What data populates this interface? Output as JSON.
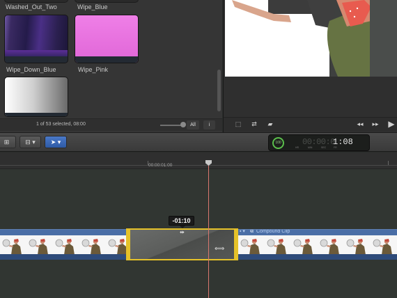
{
  "browser": {
    "clips": [
      {
        "name": "Washed_Out_Two"
      },
      {
        "name": "Wipe_Blue"
      },
      {
        "name": "Wipe_Down_Blue"
      },
      {
        "name": "Wipe_Pink"
      },
      {
        "name": ""
      }
    ],
    "status": "1 of 53 selected, 08:00",
    "filter_label": "All",
    "action_label": "i"
  },
  "viewer": {
    "controls": [
      "fit",
      "transform",
      "crop",
      "prev",
      "next",
      "play"
    ]
  },
  "toolbar": {
    "tools": [
      "append",
      "insert",
      "select-tool"
    ],
    "timecode": {
      "indicator": "100",
      "dim_digits": "00:00:0",
      "value": "1:08",
      "units": [
        "HR",
        "MIN",
        "SEC",
        "FR"
      ]
    }
  },
  "timeline": {
    "ruler_label": "00:00:01:00",
    "tooltip": "-01:10",
    "compound_clip_label": "Compound Clip"
  },
  "colors": {
    "selection": "#e6c229",
    "playhead": "#d9776f",
    "clip": "#36578f",
    "timecode_indicator": "#5bbf4c"
  }
}
